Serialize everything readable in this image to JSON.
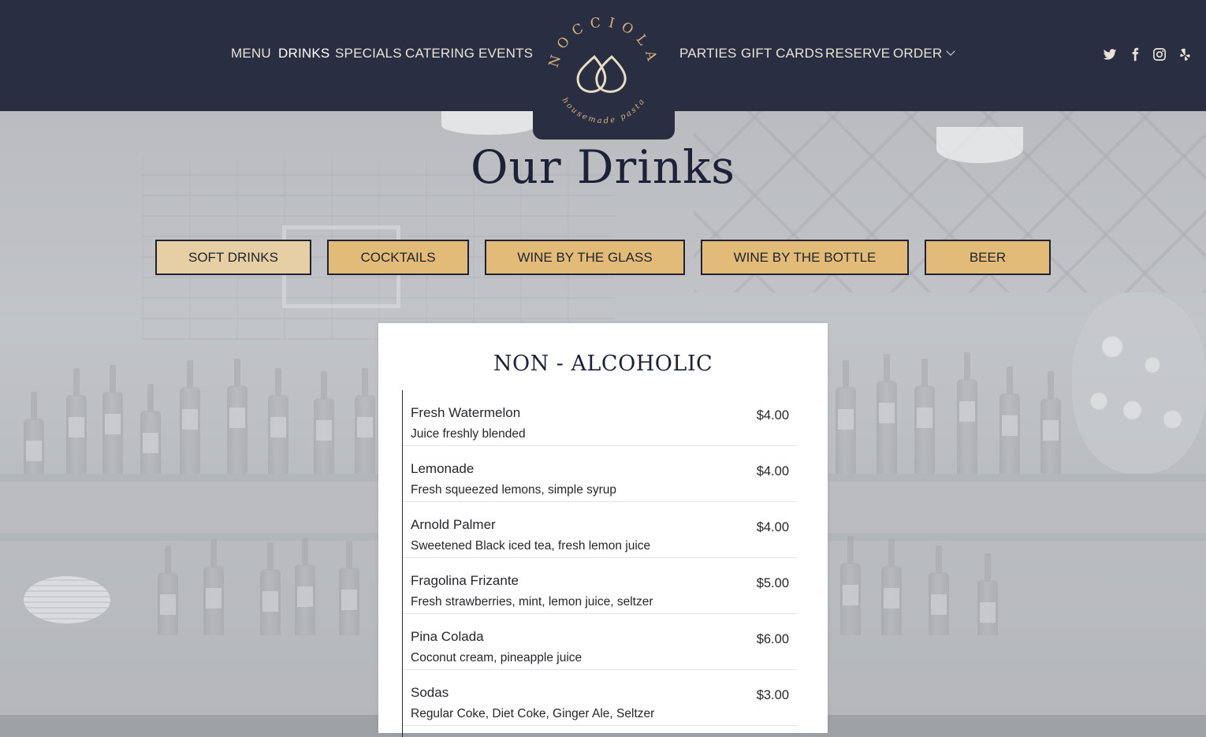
{
  "header": {
    "nav_left": [
      {
        "label": "MENU"
      },
      {
        "label": "DRINKS",
        "active": true
      },
      {
        "label": "SPECIALS"
      },
      {
        "label": "CATERING"
      },
      {
        "label": "EVENTS"
      }
    ],
    "nav_right": [
      {
        "label": "PARTIES"
      },
      {
        "label": "GIFT CARDS"
      },
      {
        "label": "RESERVE"
      },
      {
        "label": "ORDER",
        "has_dropdown": true
      }
    ],
    "logo": {
      "name": "NOCCIOLA",
      "tagline": "housemade pasta"
    },
    "social": [
      "twitter-icon",
      "facebook-icon",
      "instagram-icon",
      "yelp-icon"
    ],
    "colors": {
      "bar": "#2a2e43",
      "text": "#e9e3d6",
      "logo_gold": "#d8b27a"
    }
  },
  "page": {
    "title": "Our Drinks"
  },
  "tabs": [
    {
      "label": "SOFT DRINKS",
      "active": true
    },
    {
      "label": "COCKTAILS"
    },
    {
      "label": "WINE BY THE GLASS"
    },
    {
      "label": "WINE BY THE BOTTLE"
    },
    {
      "label": "BEER"
    }
  ],
  "tab_colors": {
    "default": "#e2bb79",
    "active": "#e6cfa4"
  },
  "menu": {
    "section_title": "NON - ALCOHOLIC",
    "items": [
      {
        "name": "Fresh Watermelon",
        "description": "Juice freshly blended",
        "price": "$4.00"
      },
      {
        "name": "Lemonade",
        "description": "Fresh squeezed lemons, simple syrup",
        "price": "$4.00"
      },
      {
        "name": "Arnold Palmer",
        "description": "Sweetened Black iced tea, fresh lemon juice",
        "price": "$4.00"
      },
      {
        "name": "Fragolina Frizante",
        "description": "Fresh strawberries, mint, lemon juice, seltzer",
        "price": "$5.00"
      },
      {
        "name": "Pina Colada",
        "description": "Coconut cream, pineapple juice",
        "price": "$6.00"
      },
      {
        "name": "Sodas",
        "description": "Regular Coke, Diet Coke, Ginger Ale, Seltzer",
        "price": "$3.00"
      }
    ]
  }
}
